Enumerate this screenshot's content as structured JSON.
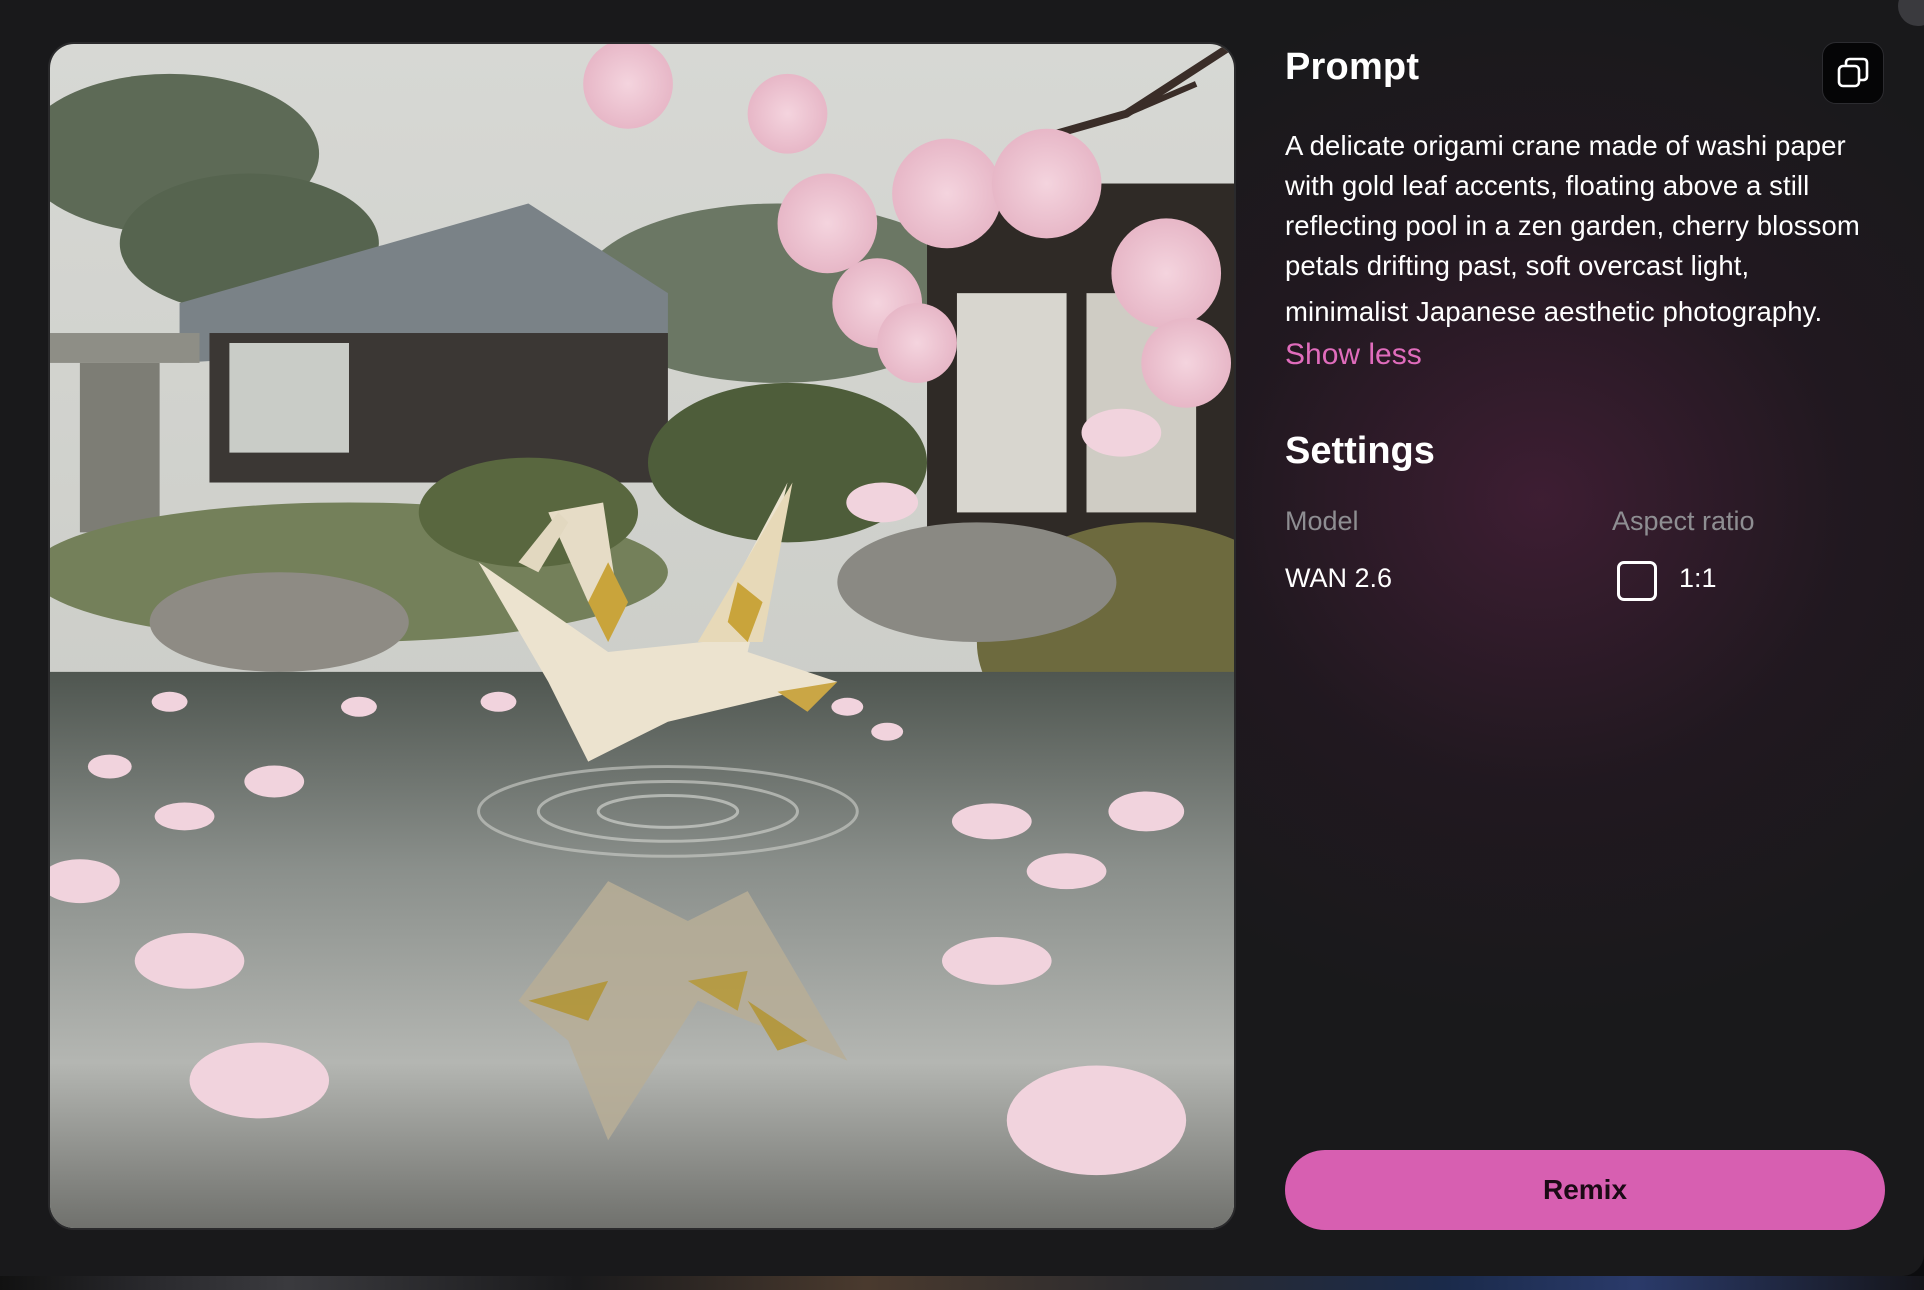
{
  "prompt": {
    "title": "Prompt",
    "copy_icon": "copy-icon",
    "lines": [
      "A delicate origami crane made of washi paper",
      "with gold leaf accents, floating above a still",
      "reflecting pool in a zen garden, cherry blossom",
      "petals drifting past, soft overcast light,",
      "minimalist Japanese aesthetic photography."
    ],
    "toggle_label": "Show less"
  },
  "settings": {
    "title": "Settings",
    "model_label": "Model",
    "model_value": "WAN 2.6",
    "aspect_label": "Aspect ratio",
    "aspect_icon": "square-icon",
    "aspect_value": "1:1"
  },
  "actions": {
    "remix_label": "Remix"
  },
  "colors": {
    "accent": "#d75fb1",
    "link": "#e06cbc",
    "background": "#19191b"
  }
}
